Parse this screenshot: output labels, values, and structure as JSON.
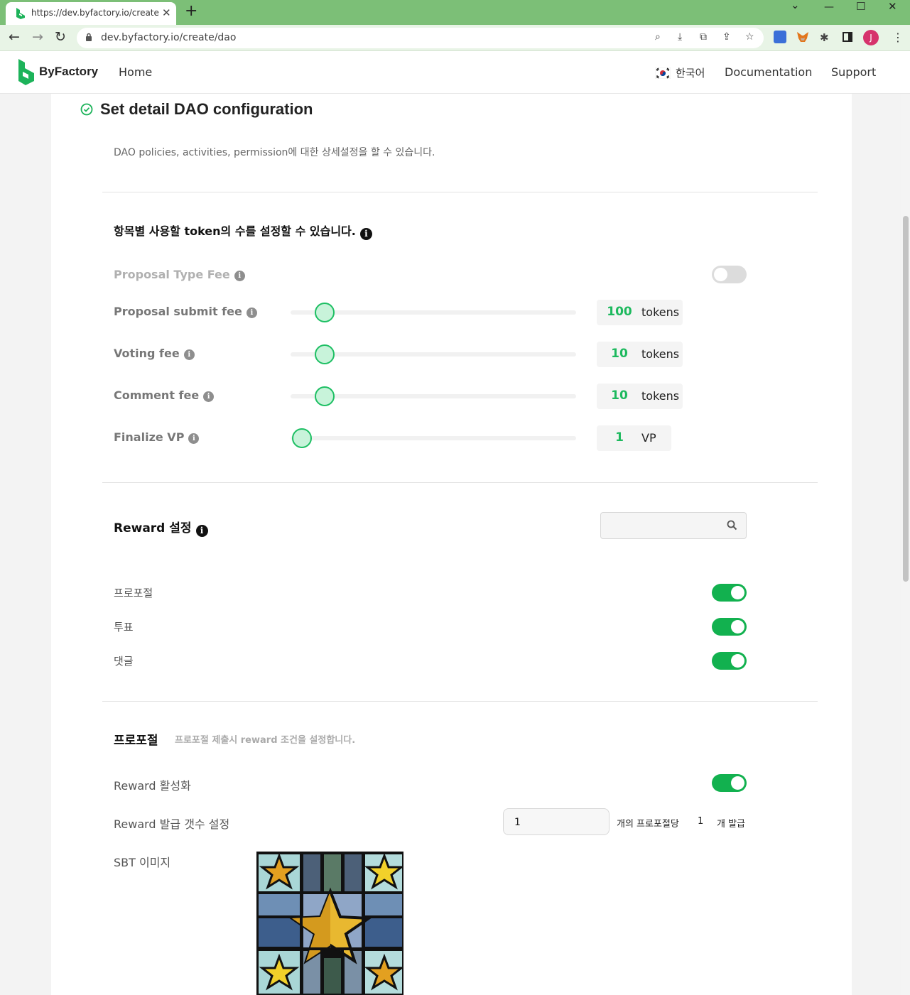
{
  "browser": {
    "tab_title": "https://dev.byfactory.io/create/d",
    "url": "dev.byfactory.io/create/dao",
    "avatar_initial": "J",
    "accent_color": "#7cbf77"
  },
  "header": {
    "brand": "ByFactory",
    "nav_home": "Home",
    "language": "한국어",
    "nav_docs": "Documentation",
    "nav_support": "Support"
  },
  "page": {
    "title": "Set detail DAO configuration",
    "subtitle": "DAO policies, activities, permission에 대한 상세설정을 할 수 있습니다."
  },
  "fees": {
    "section_title": "항목별 사용할 token의 수를 설정할 수 있습니다.",
    "proposal_type_fee": {
      "label": "Proposal Type Fee",
      "enabled": false
    },
    "items": [
      {
        "label": "Proposal submit fee",
        "value": "100",
        "unit": "tokens",
        "level": 0.12
      },
      {
        "label": "Voting fee",
        "value": "10",
        "unit": "tokens",
        "level": 0.12
      },
      {
        "label": "Comment fee",
        "value": "10",
        "unit": "tokens",
        "level": 0.12
      },
      {
        "label": "Finalize VP",
        "value": "1",
        "unit": "VP",
        "level": 0.04
      }
    ]
  },
  "reward": {
    "section_title": "Reward 설정",
    "search_placeholder": "",
    "toggles": [
      {
        "label": "프로포절",
        "enabled": true
      },
      {
        "label": "투표",
        "enabled": true
      },
      {
        "label": "댓글",
        "enabled": true
      }
    ]
  },
  "proposal": {
    "title": "프로포절",
    "description": "프로포절 제출시 reward 조건을 설정합니다.",
    "activate_label": "Reward 활성화",
    "activate_enabled": true,
    "count_label": "Reward 발급 갯수 설정",
    "count_value": "1",
    "per_label": "개의 프로포절당",
    "issue_count": "1",
    "issue_label": "개 발급",
    "sbt_label": "SBT 이미지"
  }
}
